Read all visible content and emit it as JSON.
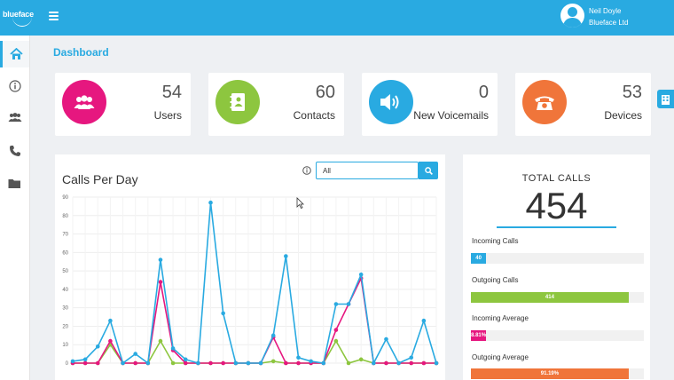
{
  "brand": {
    "name": "blueface"
  },
  "user": {
    "name": "Neil Doyle",
    "org": "Blueface Ltd"
  },
  "page_title": "Dashboard",
  "stats": [
    {
      "value": "54",
      "label": "Users",
      "color": "#e6177f",
      "icon": "users-icon"
    },
    {
      "value": "60",
      "label": "Contacts",
      "color": "#8dc63f",
      "icon": "contacts-book-icon"
    },
    {
      "value": "0",
      "label": "New Voicemails",
      "color": "#29aae1",
      "icon": "speaker-icon"
    },
    {
      "value": "53",
      "label": "Devices",
      "color": "#f0753a",
      "icon": "telephone-icon"
    }
  ],
  "sidebar": {
    "items": [
      "home-icon",
      "info-icon",
      "users-icon",
      "phone-icon",
      "folder-icon"
    ]
  },
  "calls": {
    "title": "Calls Per Day",
    "filter_value": "All"
  },
  "chart_data": {
    "type": "line",
    "yticks": [
      "0",
      "10",
      "20",
      "30",
      "40",
      "50",
      "60",
      "70",
      "80",
      "90"
    ],
    "ylim": [
      0,
      90
    ],
    "grid": true,
    "series": [
      {
        "color": "#29aae1",
        "values": [
          1,
          2,
          9,
          23,
          0,
          5,
          0,
          56,
          8,
          2,
          0,
          87,
          27,
          0,
          0,
          0,
          15,
          58,
          3,
          1,
          0,
          32,
          32,
          48,
          0,
          13,
          0,
          3,
          23,
          0
        ]
      },
      {
        "color": "#e6177f",
        "values": [
          0,
          0,
          0,
          12,
          0,
          0,
          0,
          44,
          7,
          0,
          0,
          0,
          0,
          0,
          0,
          0,
          14,
          0,
          0,
          0,
          0,
          18,
          32,
          46,
          0,
          0,
          0,
          0,
          0,
          0
        ]
      },
      {
        "color": "#8dc63f",
        "values": [
          0,
          0,
          0,
          10,
          0,
          0,
          0,
          12,
          0,
          0,
          0,
          0,
          0,
          0,
          0,
          0,
          1,
          0,
          0,
          0,
          0,
          12,
          0,
          2,
          0,
          0,
          0,
          0,
          0,
          0
        ]
      }
    ]
  },
  "totals": {
    "label": "TOTAL CALLS",
    "value": "454",
    "metrics": [
      {
        "label": "Incoming Calls",
        "value_text": "40",
        "fraction": 0.088,
        "color": "#29aae1"
      },
      {
        "label": "Outgoing Calls",
        "value_text": "414",
        "fraction": 0.912,
        "color": "#8dc63f"
      },
      {
        "label": "Incoming Average",
        "value_text": "8.81%",
        "fraction": 0.088,
        "color": "#e6177f"
      },
      {
        "label": "Outgoing Average",
        "value_text": "91.19%",
        "fraction": 0.912,
        "color": "#f0753a"
      }
    ]
  }
}
